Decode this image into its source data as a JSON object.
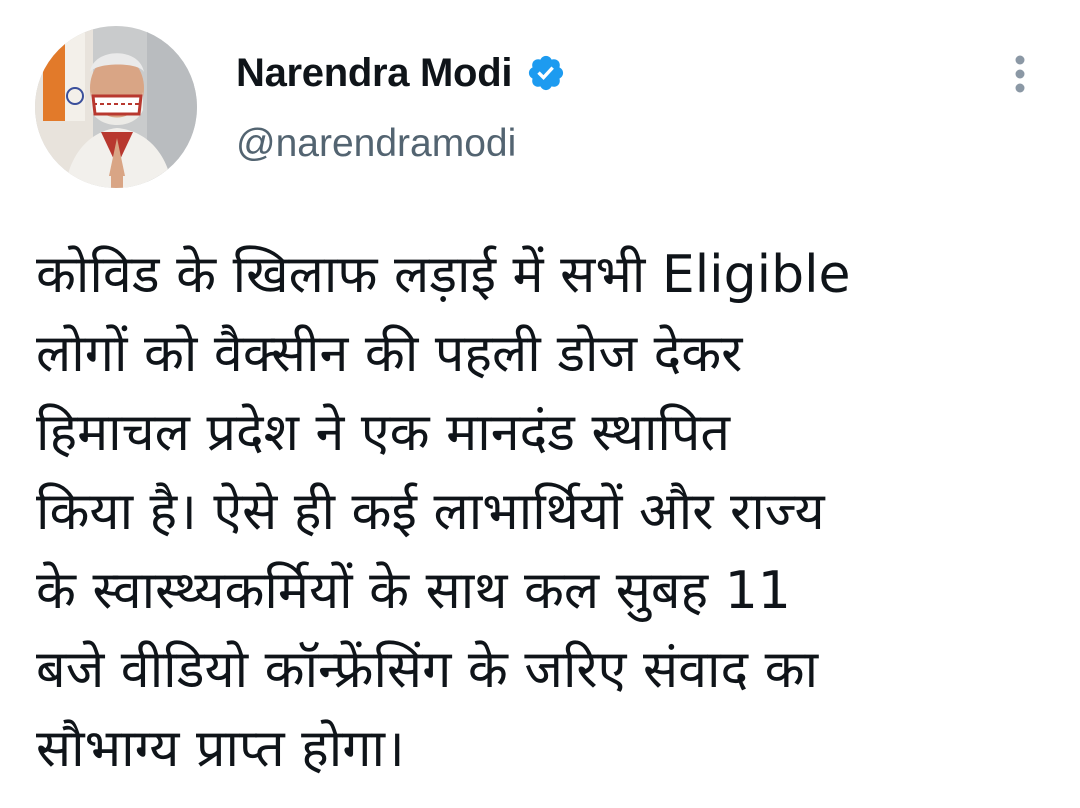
{
  "tweet": {
    "author": {
      "display_name": "Narendra Modi",
      "handle": "@narendramodi",
      "verified": true,
      "avatar_icon": "profile-photo",
      "verified_icon": "verified-badge-icon"
    },
    "menu_icon": "more-vertical-icon",
    "text_lines": [
      "कोविड के खिलाफ लड़ाई में सभी Eligible",
      "लोगों को वैक्सीन की पहली डोज देकर",
      "हिमाचल प्रदेश ने एक मानदंड स्थापित",
      "किया है। ऐसे ही कई लाभार्थियों और राज्य",
      "के स्वास्थ्यकर्मियों के साथ कल सुबह 11",
      "बजे वीडियो कॉन्फ्रेंसिंग के जरिए संवाद का",
      "सौभाग्य प्राप्त होगा।"
    ]
  },
  "colors": {
    "text_primary": "#0f1419",
    "text_secondary": "#536471",
    "verified_blue": "#1d9bf0",
    "menu_dots": "#8b98a5"
  }
}
